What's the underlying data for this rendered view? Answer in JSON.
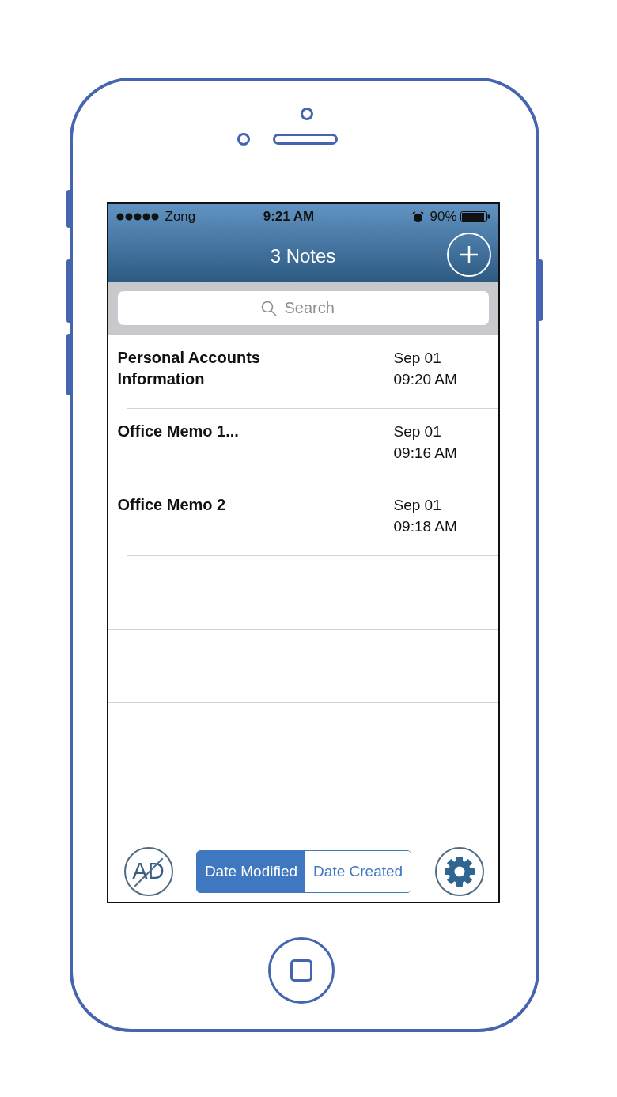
{
  "status_bar": {
    "carrier": "Zong",
    "time": "9:21 AM",
    "battery": "90%"
  },
  "nav_bar": {
    "title": "3 Notes"
  },
  "search": {
    "placeholder": "Search"
  },
  "notes": [
    {
      "title": "Personal Accounts Information",
      "date": "Sep 01",
      "time": "09:20 AM"
    },
    {
      "title": "Office Memo 1...",
      "date": "Sep 01",
      "time": "09:16 AM"
    },
    {
      "title": "Office Memo 2",
      "date": "Sep 01",
      "time": "09:18 AM"
    }
  ],
  "toolbar": {
    "remove_ads": "AD",
    "sort_options": [
      {
        "label": "Date Modified",
        "selected": true
      },
      {
        "label": "Date Created",
        "selected": false
      }
    ]
  }
}
